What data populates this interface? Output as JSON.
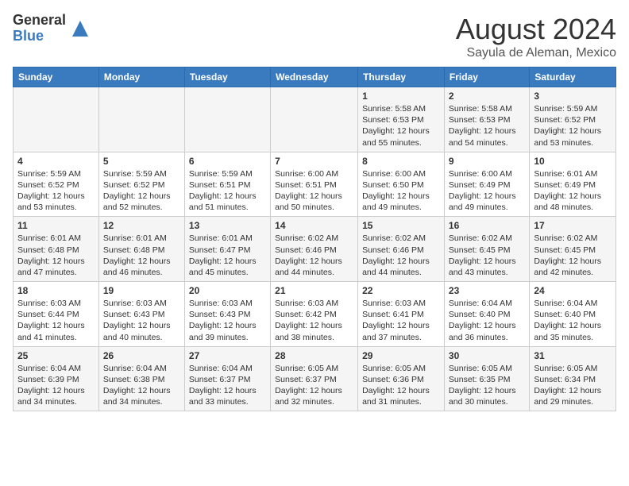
{
  "header": {
    "logo_general": "General",
    "logo_blue": "Blue",
    "month_title": "August 2024",
    "location": "Sayula de Aleman, Mexico"
  },
  "days_of_week": [
    "Sunday",
    "Monday",
    "Tuesday",
    "Wednesday",
    "Thursday",
    "Friday",
    "Saturday"
  ],
  "weeks": [
    [
      {
        "day": "",
        "info": ""
      },
      {
        "day": "",
        "info": ""
      },
      {
        "day": "",
        "info": ""
      },
      {
        "day": "",
        "info": ""
      },
      {
        "day": "1",
        "info": "Sunrise: 5:58 AM\nSunset: 6:53 PM\nDaylight: 12 hours\nand 55 minutes."
      },
      {
        "day": "2",
        "info": "Sunrise: 5:58 AM\nSunset: 6:53 PM\nDaylight: 12 hours\nand 54 minutes."
      },
      {
        "day": "3",
        "info": "Sunrise: 5:59 AM\nSunset: 6:52 PM\nDaylight: 12 hours\nand 53 minutes."
      }
    ],
    [
      {
        "day": "4",
        "info": "Sunrise: 5:59 AM\nSunset: 6:52 PM\nDaylight: 12 hours\nand 53 minutes."
      },
      {
        "day": "5",
        "info": "Sunrise: 5:59 AM\nSunset: 6:52 PM\nDaylight: 12 hours\nand 52 minutes."
      },
      {
        "day": "6",
        "info": "Sunrise: 5:59 AM\nSunset: 6:51 PM\nDaylight: 12 hours\nand 51 minutes."
      },
      {
        "day": "7",
        "info": "Sunrise: 6:00 AM\nSunset: 6:51 PM\nDaylight: 12 hours\nand 50 minutes."
      },
      {
        "day": "8",
        "info": "Sunrise: 6:00 AM\nSunset: 6:50 PM\nDaylight: 12 hours\nand 49 minutes."
      },
      {
        "day": "9",
        "info": "Sunrise: 6:00 AM\nSunset: 6:49 PM\nDaylight: 12 hours\nand 49 minutes."
      },
      {
        "day": "10",
        "info": "Sunrise: 6:01 AM\nSunset: 6:49 PM\nDaylight: 12 hours\nand 48 minutes."
      }
    ],
    [
      {
        "day": "11",
        "info": "Sunrise: 6:01 AM\nSunset: 6:48 PM\nDaylight: 12 hours\nand 47 minutes."
      },
      {
        "day": "12",
        "info": "Sunrise: 6:01 AM\nSunset: 6:48 PM\nDaylight: 12 hours\nand 46 minutes."
      },
      {
        "day": "13",
        "info": "Sunrise: 6:01 AM\nSunset: 6:47 PM\nDaylight: 12 hours\nand 45 minutes."
      },
      {
        "day": "14",
        "info": "Sunrise: 6:02 AM\nSunset: 6:46 PM\nDaylight: 12 hours\nand 44 minutes."
      },
      {
        "day": "15",
        "info": "Sunrise: 6:02 AM\nSunset: 6:46 PM\nDaylight: 12 hours\nand 44 minutes."
      },
      {
        "day": "16",
        "info": "Sunrise: 6:02 AM\nSunset: 6:45 PM\nDaylight: 12 hours\nand 43 minutes."
      },
      {
        "day": "17",
        "info": "Sunrise: 6:02 AM\nSunset: 6:45 PM\nDaylight: 12 hours\nand 42 minutes."
      }
    ],
    [
      {
        "day": "18",
        "info": "Sunrise: 6:03 AM\nSunset: 6:44 PM\nDaylight: 12 hours\nand 41 minutes."
      },
      {
        "day": "19",
        "info": "Sunrise: 6:03 AM\nSunset: 6:43 PM\nDaylight: 12 hours\nand 40 minutes."
      },
      {
        "day": "20",
        "info": "Sunrise: 6:03 AM\nSunset: 6:43 PM\nDaylight: 12 hours\nand 39 minutes."
      },
      {
        "day": "21",
        "info": "Sunrise: 6:03 AM\nSunset: 6:42 PM\nDaylight: 12 hours\nand 38 minutes."
      },
      {
        "day": "22",
        "info": "Sunrise: 6:03 AM\nSunset: 6:41 PM\nDaylight: 12 hours\nand 37 minutes."
      },
      {
        "day": "23",
        "info": "Sunrise: 6:04 AM\nSunset: 6:40 PM\nDaylight: 12 hours\nand 36 minutes."
      },
      {
        "day": "24",
        "info": "Sunrise: 6:04 AM\nSunset: 6:40 PM\nDaylight: 12 hours\nand 35 minutes."
      }
    ],
    [
      {
        "day": "25",
        "info": "Sunrise: 6:04 AM\nSunset: 6:39 PM\nDaylight: 12 hours\nand 34 minutes."
      },
      {
        "day": "26",
        "info": "Sunrise: 6:04 AM\nSunset: 6:38 PM\nDaylight: 12 hours\nand 34 minutes."
      },
      {
        "day": "27",
        "info": "Sunrise: 6:04 AM\nSunset: 6:37 PM\nDaylight: 12 hours\nand 33 minutes."
      },
      {
        "day": "28",
        "info": "Sunrise: 6:05 AM\nSunset: 6:37 PM\nDaylight: 12 hours\nand 32 minutes."
      },
      {
        "day": "29",
        "info": "Sunrise: 6:05 AM\nSunset: 6:36 PM\nDaylight: 12 hours\nand 31 minutes."
      },
      {
        "day": "30",
        "info": "Sunrise: 6:05 AM\nSunset: 6:35 PM\nDaylight: 12 hours\nand 30 minutes."
      },
      {
        "day": "31",
        "info": "Sunrise: 6:05 AM\nSunset: 6:34 PM\nDaylight: 12 hours\nand 29 minutes."
      }
    ]
  ]
}
